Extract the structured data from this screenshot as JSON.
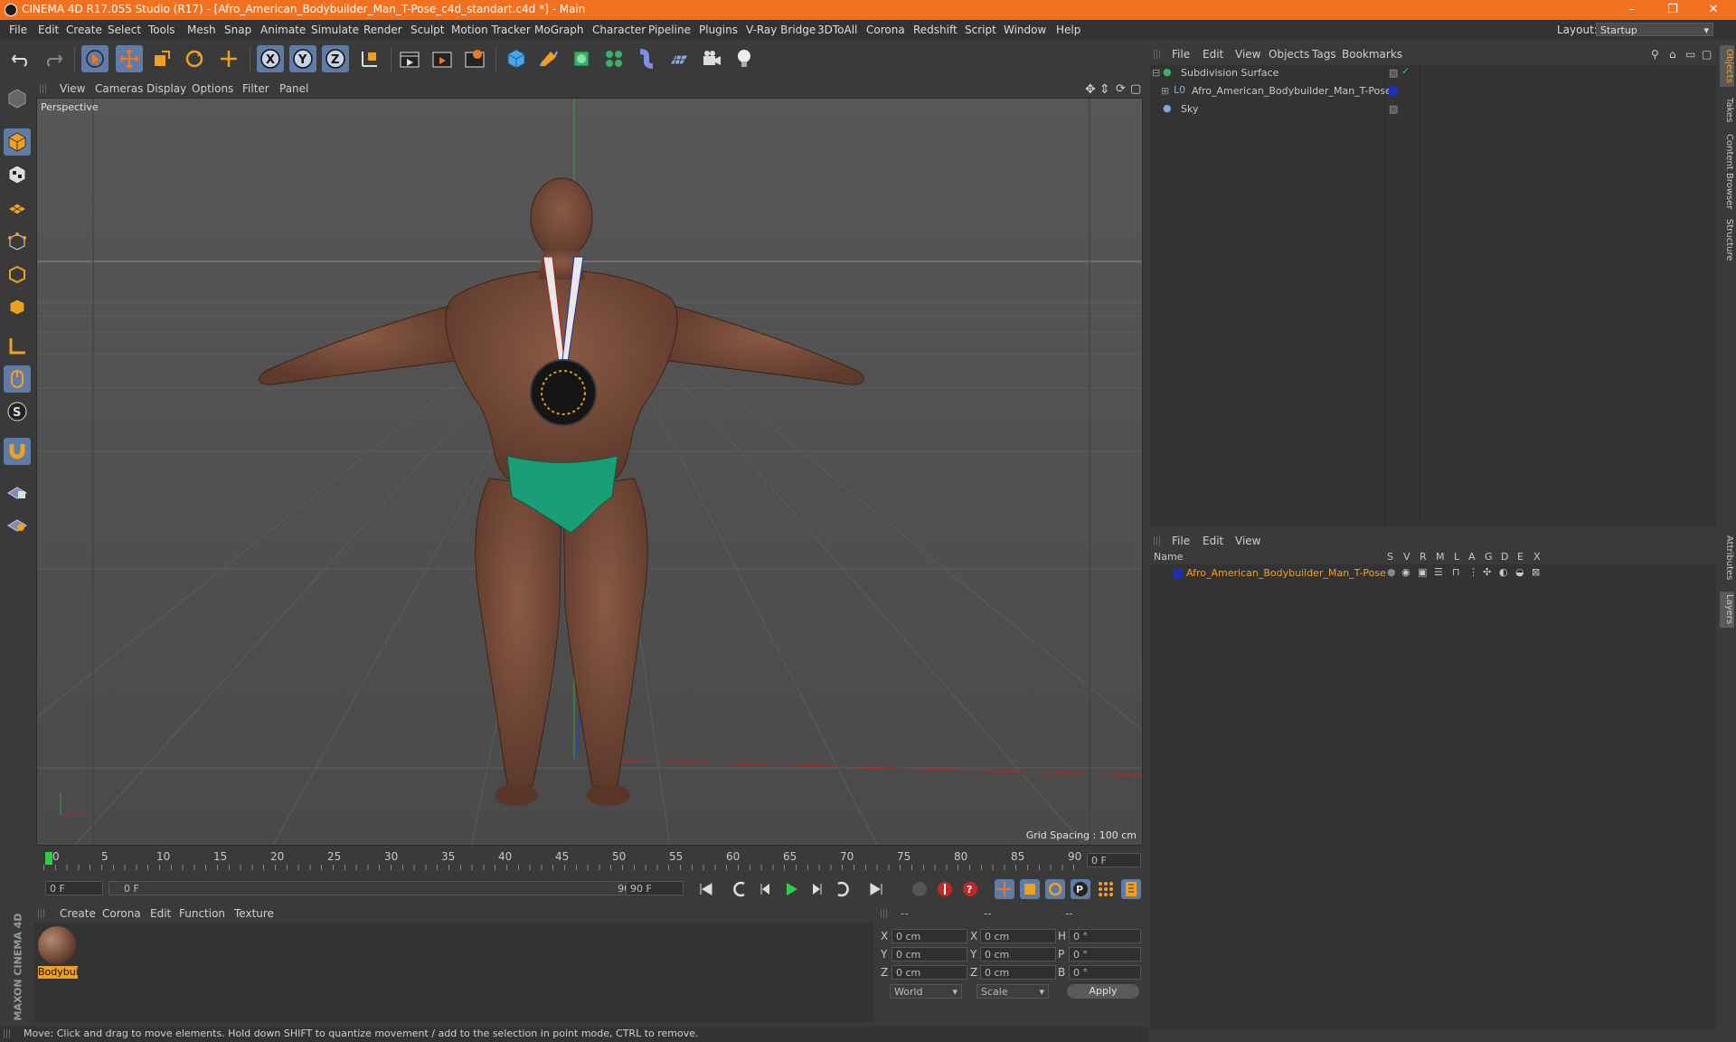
{
  "window": {
    "title": "CINEMA 4D R17.055 Studio (R17) - [Afro_American_Bodybuilder_Man_T-Pose_c4d_standart.c4d *] - Main",
    "controls": [
      "–",
      "❐",
      "✕"
    ]
  },
  "menubar": {
    "items": [
      "File",
      "Edit",
      "Create",
      "Select",
      "Tools",
      "Mesh",
      "Snap",
      "Animate",
      "Simulate",
      "Render",
      "Sculpt",
      "Motion Tracker",
      "MoGraph",
      "Character",
      "Pipeline",
      "Plugins",
      "V-Ray Bridge",
      "3DToAll",
      "Corona",
      "Redshift",
      "Script",
      "Window",
      "Help"
    ],
    "layout_label": "Layout:",
    "layout_value": "Startup"
  },
  "viewport": {
    "menu": [
      "View",
      "Cameras",
      "Display",
      "Options",
      "Filter",
      "Panel"
    ],
    "camera_label": "Perspective",
    "grid_spacing": "Grid Spacing : 100 cm"
  },
  "timeline": {
    "ticks": [
      "0",
      "5",
      "10",
      "15",
      "20",
      "25",
      "30",
      "35",
      "40",
      "45",
      "50",
      "55",
      "60",
      "65",
      "70",
      "75",
      "80",
      "85",
      "90"
    ],
    "current_frame": "0 F",
    "start_field": "0 F",
    "range_start": "0 F",
    "range_end": "90 F",
    "end_field": "90 F"
  },
  "material_manager": {
    "menu": [
      "Create",
      "Corona",
      "Edit",
      "Function",
      "Texture"
    ],
    "material_name": "Bodybui"
  },
  "coordinates": {
    "headers": [
      "--",
      "--",
      "--"
    ],
    "rows": [
      {
        "axis": "X",
        "pos": "0 cm",
        "axis2": "X",
        "size": "0 cm",
        "rot_axis": "H",
        "rot": "0 °"
      },
      {
        "axis": "Y",
        "pos": "0 cm",
        "axis2": "Y",
        "size": "0 cm",
        "rot_axis": "P",
        "rot": "0 °"
      },
      {
        "axis": "Z",
        "pos": "0 cm",
        "axis2": "Z",
        "size": "0 cm",
        "rot_axis": "B",
        "rot": "0 °"
      }
    ],
    "mode1": "World",
    "mode2": "Scale",
    "apply": "Apply"
  },
  "object_manager": {
    "menu": [
      "File",
      "Edit",
      "View",
      "Objects",
      "Tags",
      "Bookmarks"
    ],
    "objects": [
      {
        "name": "Subdivision Surface",
        "color": "#cccccc"
      },
      {
        "name": "Afro_American_Bodybuilder_Man_T-Pose",
        "color": "#cccccc"
      },
      {
        "name": "Sky",
        "color": "#cccccc"
      }
    ]
  },
  "layer_manager": {
    "menu": [
      "File",
      "Edit",
      "View"
    ],
    "columns": [
      "Name",
      "S",
      "V",
      "R",
      "M",
      "L",
      "A",
      "G",
      "D",
      "E",
      "X"
    ],
    "layers": [
      {
        "name": "Afro_American_Bodybuilder_Man_T-Pose",
        "color": "#f0a030",
        "swatch": "#1f2dbf"
      }
    ]
  },
  "right_tabs": [
    "Objects",
    "Takes",
    "Content Browser",
    "Structure",
    "Attributes",
    "Layers"
  ],
  "statusbar": {
    "text": "Move: Click and drag to move elements. Hold down SHIFT to quantize movement / add to the selection in point mode, CTRL to remove."
  },
  "branding": "MAXON CINEMA 4D"
}
